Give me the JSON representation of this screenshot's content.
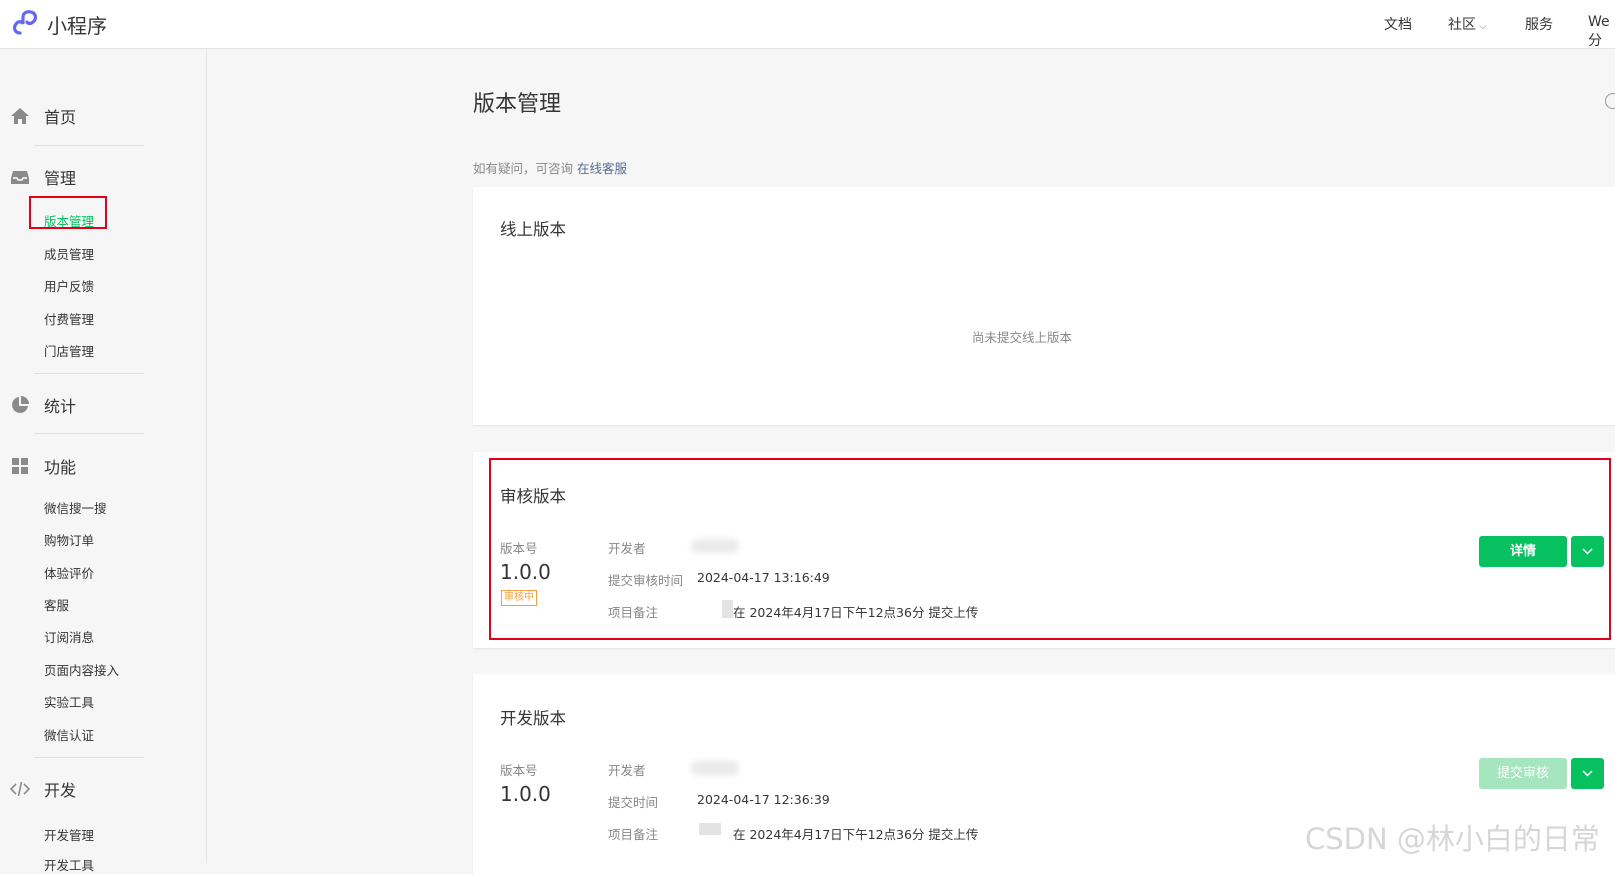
{
  "header": {
    "brand": "小程序",
    "nav": [
      "文档",
      "社区",
      "服务",
      "We分"
    ]
  },
  "sidebar": {
    "home": "首页",
    "manage": "管理",
    "manage_items": [
      "版本管理",
      "成员管理",
      "用户反馈",
      "付费管理",
      "门店管理"
    ],
    "stats": "统计",
    "features": "功能",
    "feature_items": [
      "微信搜一搜",
      "购物订单",
      "体验评价",
      "客服",
      "订阅消息",
      "页面内容接入",
      "实验工具",
      "微信认证"
    ],
    "dev": "开发",
    "dev_items": [
      "开发管理",
      "开发工具"
    ]
  },
  "main": {
    "title": "版本管理",
    "hint_prefix": "如有疑问，可咨询",
    "hint_link": "在线客服",
    "online": {
      "title": "线上版本",
      "empty": "尚未提交线上版本"
    },
    "review": {
      "title": "审核版本",
      "version_label": "版本号",
      "version": "1.0.0",
      "status": "审核中",
      "developer_label": "开发者",
      "submit_time_label": "提交审核时间",
      "submit_time": "2024-04-17 13:16:49",
      "note_label": "项目备注",
      "note": "在 2024年4月17日下午12点36分 提交上传",
      "detail_button": "详情"
    },
    "dev": {
      "title": "开发版本",
      "version_label": "版本号",
      "version": "1.0.0",
      "developer_label": "开发者",
      "submit_time_label": "提交时间",
      "submit_time": "2024-04-17 12:36:39",
      "note_label": "项目备注",
      "note": "在 2024年4月17日下午12点36分 提交上传",
      "submit_button": "提交审核"
    }
  },
  "watermark": "CSDN @林小白的日常",
  "colors": {
    "brand_green": "#07c160",
    "link_blue": "#576b95",
    "highlight_red": "#e5001a",
    "status_orange": "#fa9d3b"
  }
}
